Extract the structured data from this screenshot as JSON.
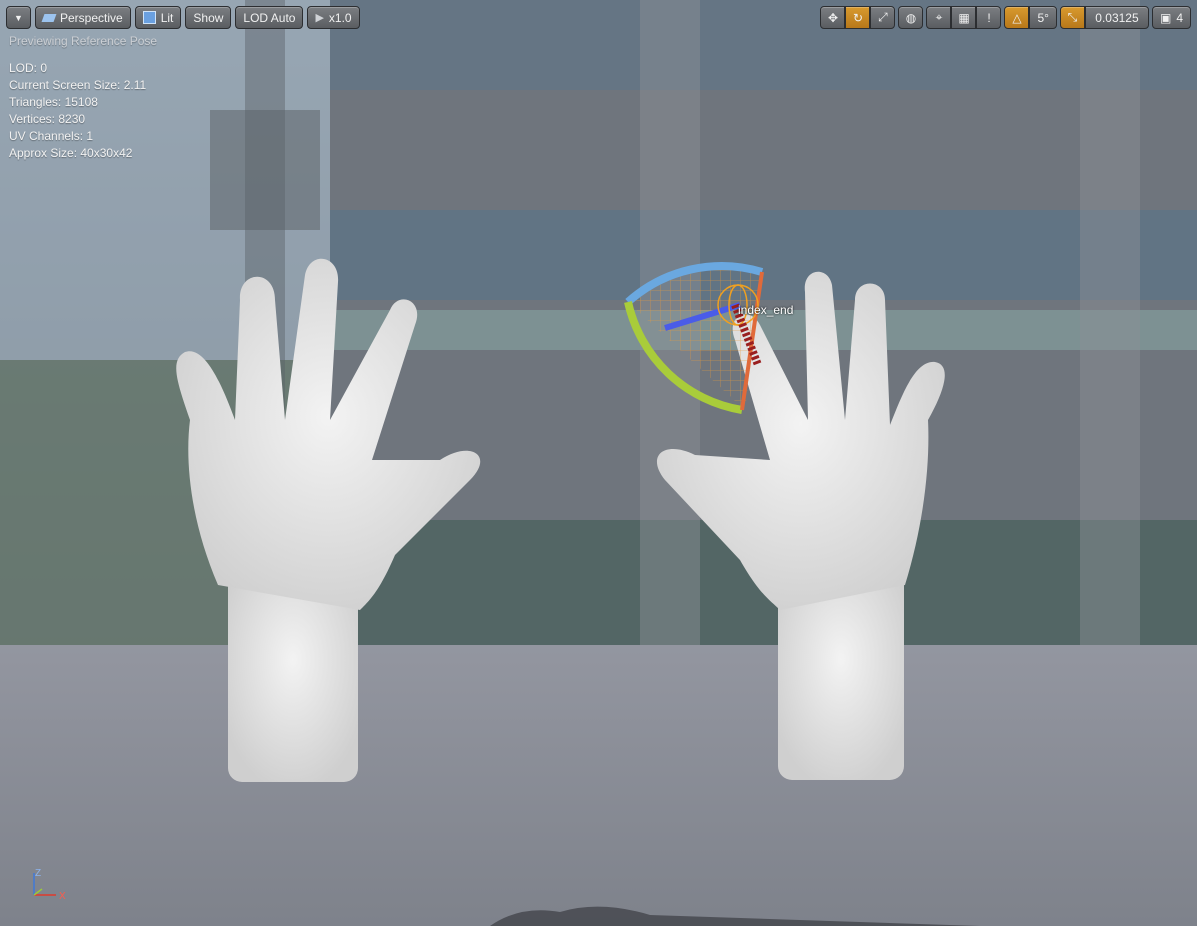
{
  "toolbar_left": {
    "menu_icon": "chevron-down-icon",
    "perspective_label": "Perspective",
    "lit_label": "Lit",
    "show_label": "Show",
    "lod_label": "LOD Auto",
    "speed_label": "x1.0"
  },
  "toolbar_right": {
    "snap_angle": "5°",
    "scale_value": "0.03125",
    "camera_speed": "4"
  },
  "overlay": {
    "preview_text": "Previewing Reference Pose",
    "stats": [
      "LOD: 0",
      "Current Screen Size: 2.11",
      "Triangles: 15108",
      "Vertices: 8230",
      "UV Channels: 1",
      "Approx Size: 40x30x42"
    ]
  },
  "bone": {
    "label": "index_end"
  },
  "axis": {
    "z": "Z",
    "x": "X"
  },
  "colors": {
    "accent": "#d89a2e",
    "axis_x": "#e03a2c",
    "axis_z": "#3f78d8",
    "axis_y": "#9bc93a"
  }
}
